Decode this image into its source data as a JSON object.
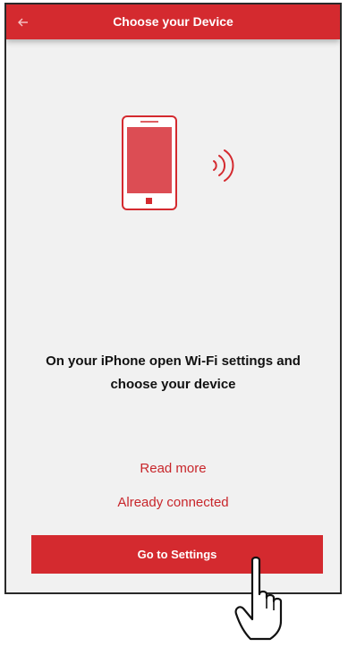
{
  "app_bar": {
    "back_icon": "arrow-left-icon",
    "title": "Choose your Device"
  },
  "illustration": {
    "phone_icon": "smartphone-icon",
    "signal_icon": "wireless-signal-icon"
  },
  "instruction": {
    "line1": "On your iPhone open Wi-Fi settings and",
    "line2": "choose your device"
  },
  "links": {
    "read_more": "Read more",
    "already_connected": "Already connected"
  },
  "primary_button": {
    "label": "Go to Settings"
  },
  "pointer": {
    "icon": "hand-pointer-icon"
  },
  "colors": {
    "accent": "#d42a2f",
    "link": "#c8262b",
    "background": "#f1f1f1"
  }
}
